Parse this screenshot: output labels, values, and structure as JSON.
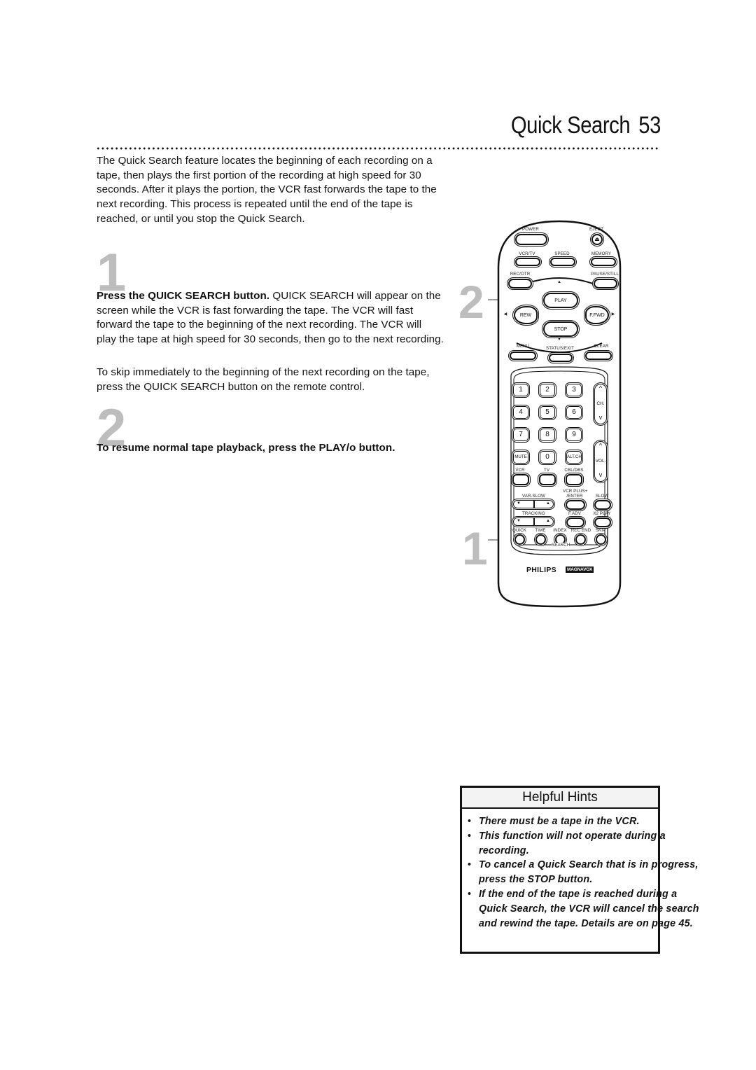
{
  "header": {
    "title": "Quick Search",
    "page_number": "53"
  },
  "intro": "The Quick Search feature locates the beginning of each recording on a tape, then plays the first portion of the recording at high speed for 30 seconds. After it plays the portion, the VCR fast forwards the tape to the next recording. This process is repeated until the end of the tape is reached, or until you stop the Quick Search.",
  "steps": [
    {
      "number": "1",
      "heading": "Press the QUICK SEARCH button.",
      "text": " QUICK SEARCH will appear on the screen while the VCR is fast forwarding the tape. The VCR will fast forward the tape to the beginning of the next recording. The VCR will play the tape at high speed for 30 seconds, then go to the next recording.",
      "extra": "To skip immediately to the beginning of the next recording on the tape, press the QUICK SEARCH button on the remote control."
    },
    {
      "number": "2",
      "heading": "To resume normal tape playback, press the PLAY/o button."
    }
  ],
  "callouts": [
    "2",
    "1"
  ],
  "remote": {
    "labels": {
      "power": "POWER",
      "eject": "EJECT",
      "eject_glyph": "⏏",
      "vcr_tv": "VCR/TV",
      "speed": "SPEED",
      "memory": "MEMORY",
      "rec_otr": "REC/OTR",
      "pause_still": "PAUSE/STILL",
      "play": "PLAY",
      "rew": "REW",
      "ffwd": "F.FWD",
      "stop": "STOP",
      "menu": "MENU",
      "status_exit": "STATUS/EXIT",
      "clear": "CLEAR",
      "ch": "CH.",
      "vol": "VOL.",
      "mute": "MUTE",
      "zero": "0",
      "alt_ch": "ALT.CH",
      "vcr": "VCR",
      "tv": "TV",
      "cbl_dbs": "CBL/DBS",
      "var_slow": "VAR.SLOW",
      "vcr_plus": "VCR PLUS+",
      "enter": "/ENTER",
      "slow": "SLOW",
      "tracking": "TRACKING",
      "f_adv": "F.ADV",
      "x2_play": "X2 PLAY",
      "quick": "QUICK",
      "time": "TIME",
      "index": "INDEX",
      "rec_end": "REC END",
      "skip": "SKIP",
      "search": "SEARCH",
      "brand": "PHILIPS",
      "brand2": "MAGNAVOX",
      "up": "^",
      "down": "v",
      "tri_up": "▲",
      "tri_down": "▼",
      "tri_left": "◀",
      "tri_right": "▶"
    },
    "digits": [
      "1",
      "2",
      "3",
      "4",
      "5",
      "6",
      "7",
      "8",
      "9"
    ]
  },
  "hints": {
    "title": "Helpful Hints",
    "items": [
      "There must be a tape in the VCR.",
      "This function will not operate during a recording.",
      "To cancel a Quick Search that is in progress, press the STOP button.",
      "If the end of the tape is reached during a Quick Search, the VCR will cancel the search and rewind the tape. Details are on page 45."
    ],
    "bullet": "•"
  }
}
